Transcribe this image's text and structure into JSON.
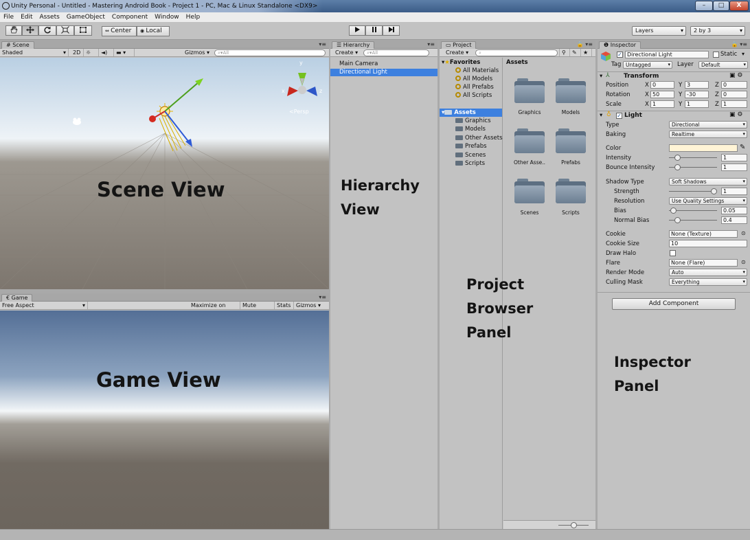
{
  "window": {
    "title": "Unity Personal - Untitled - Mastering Android Book - Project 1 - PC, Mac & Linux Standalone <DX9>",
    "min_label": "–",
    "max_label": "□",
    "close_label": "X"
  },
  "menu": [
    "File",
    "Edit",
    "Assets",
    "GameObject",
    "Component",
    "Window",
    "Help"
  ],
  "toolbar": {
    "center_label": "Center",
    "local_label": "Local",
    "layers_label": "Layers",
    "layout_label": "2 by 3"
  },
  "scene": {
    "tab": "Scene",
    "shaded": "Shaded",
    "mode_2d": "2D",
    "gizmos": "Gizmos",
    "search_placeholder": "All",
    "persp": "Persp",
    "axis_x": "x",
    "axis_z": "z",
    "overlay": "Scene View"
  },
  "game": {
    "tab": "Game",
    "aspect": "Free Aspect",
    "maximize": "Maximize on Play",
    "mute": "Mute audio",
    "stats": "Stats",
    "gizmos": "Gizmos",
    "overlay": "Game View"
  },
  "hierarchy": {
    "tab": "Hierarchy",
    "create": "Create",
    "search_placeholder": "All",
    "items": [
      "Main Camera",
      "Directional Light"
    ],
    "overlay_line1": "Hierarchy",
    "overlay_line2": "View"
  },
  "project": {
    "tab": "Project",
    "create": "Create",
    "favorites": "Favorites",
    "favorite_items": [
      "All Materials",
      "All Models",
      "All Prefabs",
      "All Scripts"
    ],
    "assets_root": "Assets",
    "asset_tree": [
      "Graphics",
      "Models",
      "Other Assets",
      "Prefabs",
      "Scenes",
      "Scripts"
    ],
    "grid_header": "Assets",
    "grid_items": [
      "Graphics",
      "Models",
      "Other Asse..",
      "Prefabs",
      "Scenes",
      "Scripts"
    ],
    "overlay_line1": "Project",
    "overlay_line2": "Browser",
    "overlay_line3": "Panel"
  },
  "inspector": {
    "tab": "Inspector",
    "object_name": "Directional Light",
    "static_label": "Static",
    "tag_label": "Tag",
    "tag_value": "Untagged",
    "layer_label": "Layer",
    "layer_value": "Default",
    "transform": {
      "title": "Transform",
      "position_label": "Position",
      "rotation_label": "Rotation",
      "scale_label": "Scale",
      "position": [
        "0",
        "3",
        "0"
      ],
      "rotation": [
        "50",
        "-30",
        "0"
      ],
      "scale": [
        "1",
        "1",
        "1"
      ],
      "x": "X",
      "y": "Y",
      "z": "Z"
    },
    "light": {
      "title": "Light",
      "type_label": "Type",
      "type_value": "Directional",
      "baking_label": "Baking",
      "baking_value": "Realtime",
      "color_label": "Color",
      "color_value": "#fff4d6",
      "intensity_label": "Intensity",
      "intensity_value": "1",
      "intensity_fraction": 0.125,
      "bounce_label": "Bounce Intensity",
      "bounce_value": "1",
      "bounce_fraction": 0.125,
      "shadow_type_label": "Shadow Type",
      "shadow_type_value": "Soft Shadows",
      "strength_label": "Strength",
      "strength_value": "1",
      "strength_fraction": 1.0,
      "resolution_label": "Resolution",
      "resolution_value": "Use Quality Settings",
      "bias_label": "Bias",
      "bias_value": "0.05",
      "bias_fraction": 0.025,
      "normal_bias_label": "Normal Bias",
      "normal_bias_value": "0.4",
      "normal_bias_fraction": 0.13,
      "cookie_label": "Cookie",
      "cookie_value": "None (Texture)",
      "cookie_size_label": "Cookie Size",
      "cookie_size_value": "10",
      "draw_halo_label": "Draw Halo",
      "flare_label": "Flare",
      "flare_value": "None (Flare)",
      "render_mode_label": "Render Mode",
      "render_mode_value": "Auto",
      "culling_label": "Culling Mask",
      "culling_value": "Everything"
    },
    "add_component": "Add Component",
    "overlay_line1": "Inspector",
    "overlay_line2": "Panel"
  },
  "colors": {
    "selection": "#3d80df",
    "panel": "#c2c2c2"
  }
}
